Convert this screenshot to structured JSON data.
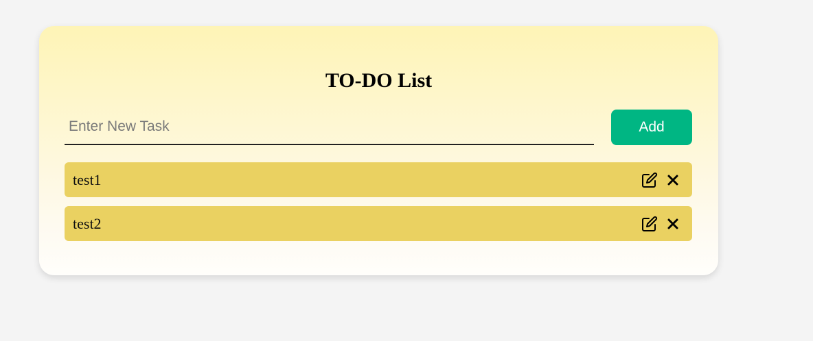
{
  "app": {
    "title": "TO-DO List"
  },
  "input": {
    "value": "",
    "placeholder": "Enter New Task"
  },
  "add_button": {
    "label": "Add"
  },
  "tasks": [
    {
      "text": "test1",
      "edit_icon": "edit-icon",
      "delete_icon": "close-icon"
    },
    {
      "text": "test2",
      "edit_icon": "edit-icon",
      "delete_icon": "close-icon"
    }
  ],
  "colors": {
    "accent": "#00b683",
    "task_background": "#ead161",
    "card_top": "#fef4b6"
  }
}
